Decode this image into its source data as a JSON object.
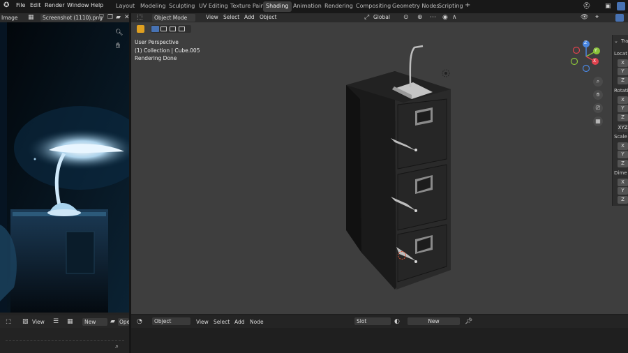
{
  "topbar": {
    "menus": [
      "File",
      "Edit",
      "Render",
      "Window",
      "Help"
    ],
    "workspaces": [
      "Layout",
      "Modeling",
      "Sculpting",
      "UV Editing",
      "Texture Paint",
      "Shading",
      "Animation",
      "Rendering",
      "Compositing",
      "Geometry Nodes",
      "Scripting"
    ],
    "active_workspace": "Shading",
    "add_tab": "+"
  },
  "image_editor": {
    "mode": "Image",
    "image_name": "Screenshot (1110).png",
    "view_menu": "View",
    "new_button": "New",
    "open_button": "Ope"
  },
  "viewport": {
    "mode": "Object Mode",
    "menus": [
      "View",
      "Select",
      "Add",
      "Object"
    ],
    "orientation": "Global",
    "overlay_lines": [
      "User Perspective",
      "(1) Collection | Cube.005",
      "Rendering Done"
    ],
    "gizmo": {
      "x": "X",
      "y": "Y",
      "z": "Z"
    }
  },
  "npanel": {
    "tab": "Tra",
    "sections": [
      {
        "label": "Locat",
        "fields": [
          "X",
          "Y",
          "Z"
        ]
      },
      {
        "label": "Rotatio",
        "fields": [
          "X",
          "Y",
          "Z"
        ]
      },
      {
        "label": "",
        "fields": [
          "XYZ"
        ]
      },
      {
        "label": "Scale",
        "fields": [
          "X",
          "Y",
          "Z"
        ]
      },
      {
        "label": "Dime",
        "fields": [
          "X",
          "Y",
          "Z"
        ]
      }
    ]
  },
  "node_editor": {
    "object_type": "Object",
    "menus": [
      "View",
      "Select",
      "Add",
      "Node"
    ],
    "slot": "Slot",
    "new_button": "New"
  },
  "colors": {
    "accent": "#4772b3",
    "viewport_bg": "#3e3e3e",
    "header_bg": "#2b2b2b",
    "x_axis": "#e0434e",
    "y_axis": "#8bc33a",
    "z_axis": "#4a87e0"
  }
}
